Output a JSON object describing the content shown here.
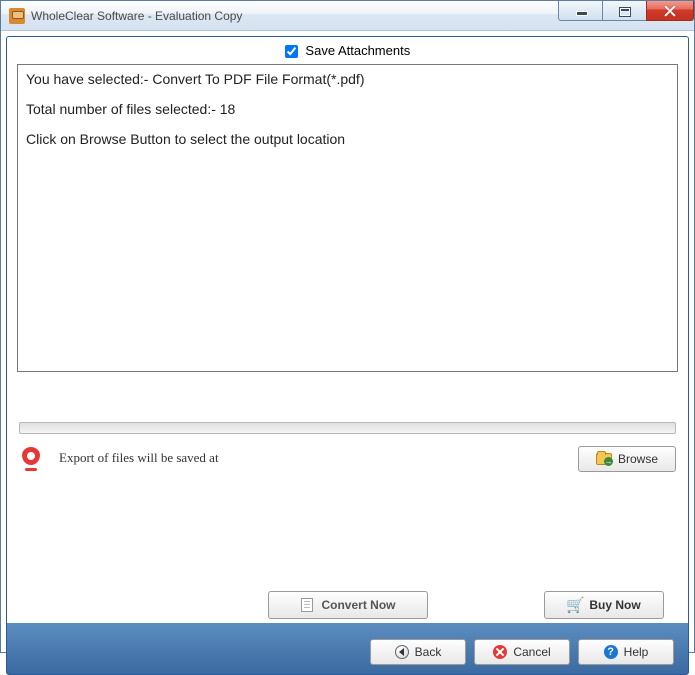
{
  "window": {
    "title": "WholeClear Software - Evaluation Copy"
  },
  "checkbox": {
    "save_attachments_label": "Save Attachments",
    "save_attachments_checked": true
  },
  "info": {
    "line1": "You have selected:- Convert To PDF File Format(*.pdf)",
    "line2": "Total number of files selected:- 18",
    "line3": "Click on Browse Button to select the output location"
  },
  "export": {
    "label": "Export of files will be saved at"
  },
  "buttons": {
    "browse": "Browse",
    "convert": "Convert Now",
    "buy": "Buy Now",
    "back": "Back",
    "cancel": "Cancel",
    "help": "Help"
  }
}
